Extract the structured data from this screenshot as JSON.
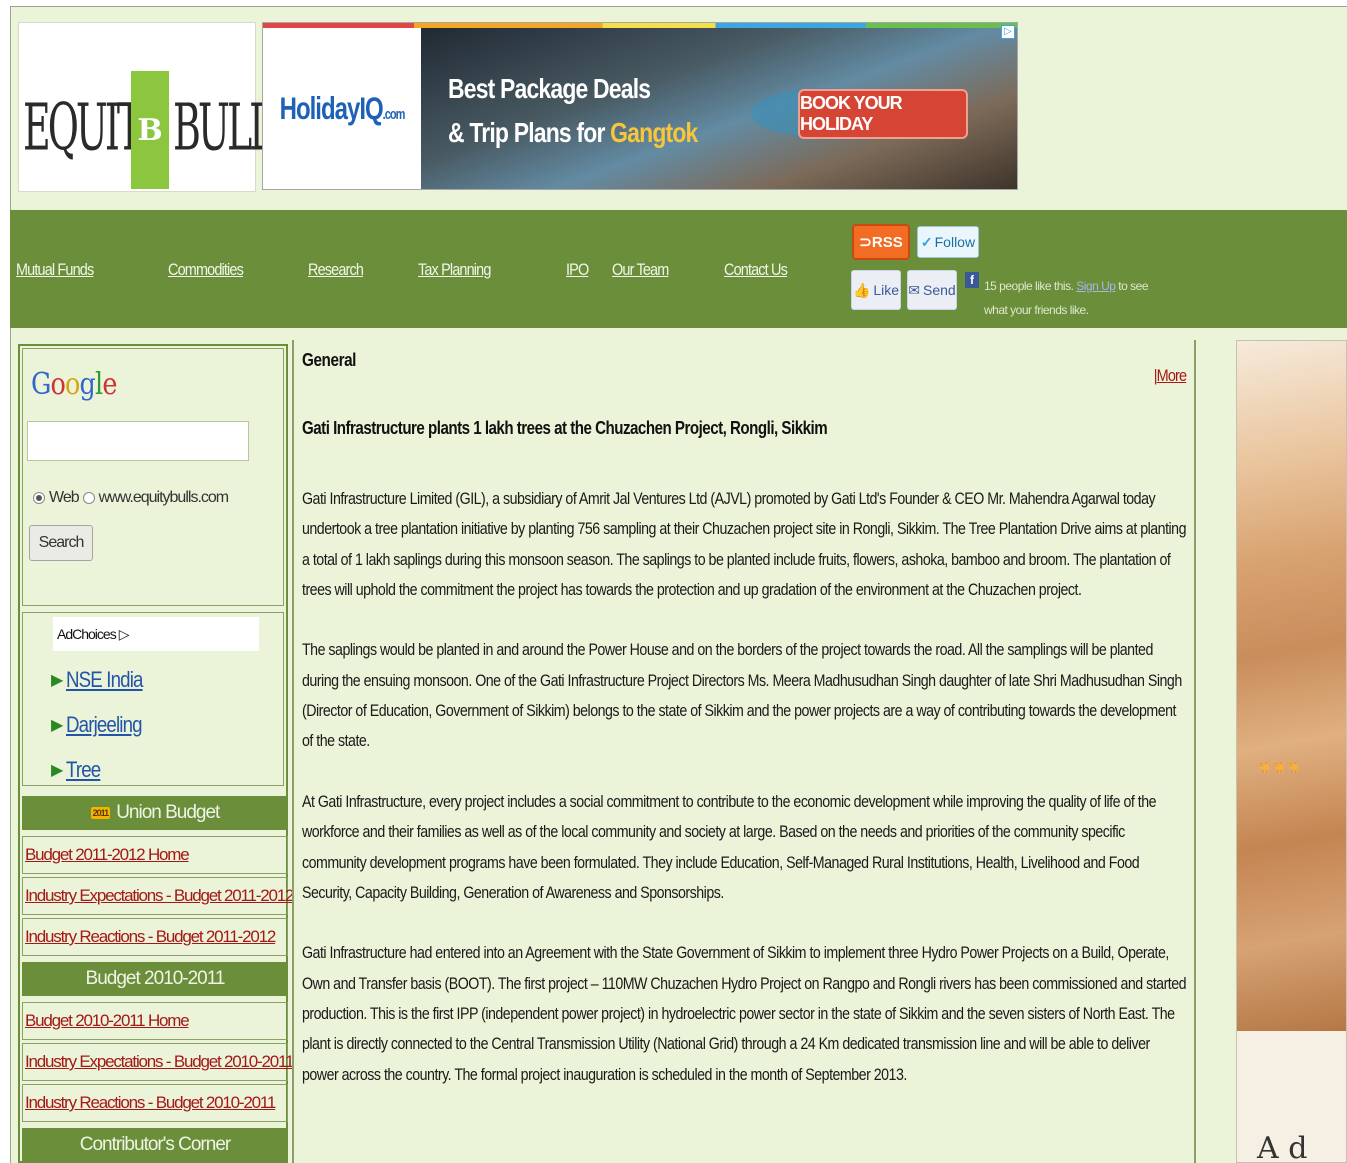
{
  "header": {
    "logo": {
      "left": "EQUITY",
      "middle": "B",
      "right": "BULLS"
    },
    "ad": {
      "brand": "HolidayIQ",
      "brand_suffix": ".com",
      "headline_line1": "Best Package Deals",
      "headline_line2": "& Trip Plans for",
      "headline_highlight": "Gangtok",
      "cta": "BOOK YOUR HOLIDAY",
      "adchoices_mark": "▷"
    }
  },
  "nav": {
    "links": [
      "Mutual Funds",
      "Commodities",
      "Research",
      "Tax Planning",
      "IPO",
      "Our Team",
      "Contact Us"
    ],
    "rss": "RSS",
    "follow": "Follow",
    "fb_like": "Like",
    "fb_send": "Send",
    "fb_text_pre": "15 people like this.",
    "fb_signup": "Sign Up",
    "fb_text_post": "to see what your friends like."
  },
  "sidebar": {
    "google": {
      "g1": "G",
      "o1": "o",
      "o2": "o",
      "g2": "g",
      "l": "l",
      "e": "e"
    },
    "radio_web": "Web",
    "radio_site": "www.equitybulls.com",
    "search_button": "Search",
    "adchoices_label": "AdChoices",
    "adchoices_mark": "▷",
    "ad_links": [
      "NSE India",
      "Darjeeling",
      "Tree"
    ],
    "union_budget_title": "Union Budget",
    "union_budget_icon": "2011",
    "budget_2011_links": [
      "Budget 2011-2012 Home",
      "Industry Expectations - Budget 2011-2012",
      "Industry Reactions - Budget 2011-2012"
    ],
    "budget_2010_title": "Budget 2010-2011",
    "budget_2010_links": [
      "Budget 2010-2011 Home",
      "Industry Expectations - Budget 2010-2011",
      "Industry Reactions - Budget 2010-2011"
    ],
    "contributor_title": "Contributor's Corner"
  },
  "main": {
    "section_title": "General",
    "more_bar": "|",
    "more_link": "More",
    "article_title": "Gati Infrastructure plants 1 lakh trees at the Chuzachen Project, Rongli, Sikkim",
    "paragraphs": [
      "Gati Infrastructure Limited (GIL), a subsidiary of Amrit Jal Ventures Ltd (AJVL) promoted by Gati Ltd's Founder & CEO Mr. Mahendra Agarwal today undertook a tree plantation initiative by planting 756 sampling at their Chuzachen project site in Rongli, Sikkim. The Tree Plantation Drive aims at planting a total of 1 lakh saplings during this monsoon season. The saplings to be planted include fruits, flowers, ashoka, bamboo and broom. The plantation of trees will uphold the commitment the project has towards the protection and up gradation of the environment at the Chuzachen project.",
      "The saplings would be planted in and around the Power House and on the borders of the project towards the road. All the samplings will be planted during the ensuing monsoon. One of the Gati Infrastructure Project Directors Ms. Meera Madhusudhan Singh daughter of late Shri Madhusudhan Singh (Director of Education, Government of Sikkim) belongs to the state of Sikkim and the power projects are a way of contributing towards the development of the state.",
      "At Gati Infrastructure, every project includes a social commitment to contribute to the economic development while improving the quality of life of the workforce and their families as well as of the local community and society at large. Based on the needs and priorities of the community specific community development programs have been formulated. They include Education, Self-Managed Rural Institutions, Health, Livelihood and Food Security, Capacity Building, Generation of Awareness and Sponsorships.",
      "Gati Infrastructure had entered into an Agreement with the State Government of Sikkim to implement three Hydro Power Projects on a Build, Operate, Own and Transfer basis (BOOT). The first project – 110MW Chuzachen Hydro Project on Rangpo and Rongli rivers has been commissioned and started production. This is the first IPP (independent power project) in hydroelectric power sector in the state of Sikkim and the seven sisters of North East. The plant is directly connected to the Central Transmission Utility (National Grid) through a 24 Km dedicated transmission line and will be able to deliver power across the country. The formal project inauguration is scheduled in the month of September 2013."
    ]
  },
  "right_ad": {
    "text": "A d"
  },
  "colors": {
    "page_bg": "#ebf3d8",
    "nav_bg": "#6b8e3a",
    "link_red": "#a51818",
    "ad_link_blue": "#2255aa"
  }
}
